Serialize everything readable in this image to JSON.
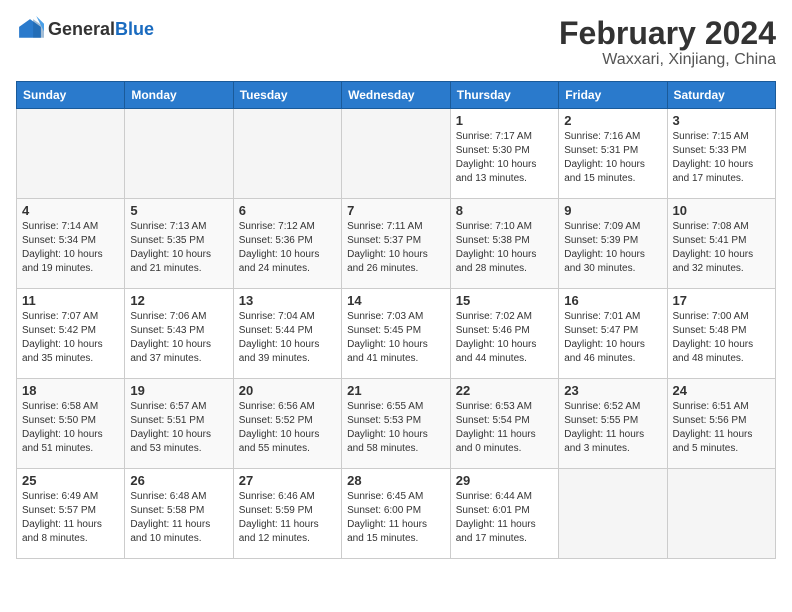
{
  "header": {
    "logo_general": "General",
    "logo_blue": "Blue",
    "title": "February 2024",
    "subtitle": "Waxxari, Xinjiang, China"
  },
  "weekdays": [
    "Sunday",
    "Monday",
    "Tuesday",
    "Wednesday",
    "Thursday",
    "Friday",
    "Saturday"
  ],
  "weeks": [
    [
      {
        "day": "",
        "info": ""
      },
      {
        "day": "",
        "info": ""
      },
      {
        "day": "",
        "info": ""
      },
      {
        "day": "",
        "info": ""
      },
      {
        "day": "1",
        "info": "Sunrise: 7:17 AM\nSunset: 5:30 PM\nDaylight: 10 hours\nand 13 minutes."
      },
      {
        "day": "2",
        "info": "Sunrise: 7:16 AM\nSunset: 5:31 PM\nDaylight: 10 hours\nand 15 minutes."
      },
      {
        "day": "3",
        "info": "Sunrise: 7:15 AM\nSunset: 5:33 PM\nDaylight: 10 hours\nand 17 minutes."
      }
    ],
    [
      {
        "day": "4",
        "info": "Sunrise: 7:14 AM\nSunset: 5:34 PM\nDaylight: 10 hours\nand 19 minutes."
      },
      {
        "day": "5",
        "info": "Sunrise: 7:13 AM\nSunset: 5:35 PM\nDaylight: 10 hours\nand 21 minutes."
      },
      {
        "day": "6",
        "info": "Sunrise: 7:12 AM\nSunset: 5:36 PM\nDaylight: 10 hours\nand 24 minutes."
      },
      {
        "day": "7",
        "info": "Sunrise: 7:11 AM\nSunset: 5:37 PM\nDaylight: 10 hours\nand 26 minutes."
      },
      {
        "day": "8",
        "info": "Sunrise: 7:10 AM\nSunset: 5:38 PM\nDaylight: 10 hours\nand 28 minutes."
      },
      {
        "day": "9",
        "info": "Sunrise: 7:09 AM\nSunset: 5:39 PM\nDaylight: 10 hours\nand 30 minutes."
      },
      {
        "day": "10",
        "info": "Sunrise: 7:08 AM\nSunset: 5:41 PM\nDaylight: 10 hours\nand 32 minutes."
      }
    ],
    [
      {
        "day": "11",
        "info": "Sunrise: 7:07 AM\nSunset: 5:42 PM\nDaylight: 10 hours\nand 35 minutes."
      },
      {
        "day": "12",
        "info": "Sunrise: 7:06 AM\nSunset: 5:43 PM\nDaylight: 10 hours\nand 37 minutes."
      },
      {
        "day": "13",
        "info": "Sunrise: 7:04 AM\nSunset: 5:44 PM\nDaylight: 10 hours\nand 39 minutes."
      },
      {
        "day": "14",
        "info": "Sunrise: 7:03 AM\nSunset: 5:45 PM\nDaylight: 10 hours\nand 41 minutes."
      },
      {
        "day": "15",
        "info": "Sunrise: 7:02 AM\nSunset: 5:46 PM\nDaylight: 10 hours\nand 44 minutes."
      },
      {
        "day": "16",
        "info": "Sunrise: 7:01 AM\nSunset: 5:47 PM\nDaylight: 10 hours\nand 46 minutes."
      },
      {
        "day": "17",
        "info": "Sunrise: 7:00 AM\nSunset: 5:48 PM\nDaylight: 10 hours\nand 48 minutes."
      }
    ],
    [
      {
        "day": "18",
        "info": "Sunrise: 6:58 AM\nSunset: 5:50 PM\nDaylight: 10 hours\nand 51 minutes."
      },
      {
        "day": "19",
        "info": "Sunrise: 6:57 AM\nSunset: 5:51 PM\nDaylight: 10 hours\nand 53 minutes."
      },
      {
        "day": "20",
        "info": "Sunrise: 6:56 AM\nSunset: 5:52 PM\nDaylight: 10 hours\nand 55 minutes."
      },
      {
        "day": "21",
        "info": "Sunrise: 6:55 AM\nSunset: 5:53 PM\nDaylight: 10 hours\nand 58 minutes."
      },
      {
        "day": "22",
        "info": "Sunrise: 6:53 AM\nSunset: 5:54 PM\nDaylight: 11 hours\nand 0 minutes."
      },
      {
        "day": "23",
        "info": "Sunrise: 6:52 AM\nSunset: 5:55 PM\nDaylight: 11 hours\nand 3 minutes."
      },
      {
        "day": "24",
        "info": "Sunrise: 6:51 AM\nSunset: 5:56 PM\nDaylight: 11 hours\nand 5 minutes."
      }
    ],
    [
      {
        "day": "25",
        "info": "Sunrise: 6:49 AM\nSunset: 5:57 PM\nDaylight: 11 hours\nand 8 minutes."
      },
      {
        "day": "26",
        "info": "Sunrise: 6:48 AM\nSunset: 5:58 PM\nDaylight: 11 hours\nand 10 minutes."
      },
      {
        "day": "27",
        "info": "Sunrise: 6:46 AM\nSunset: 5:59 PM\nDaylight: 11 hours\nand 12 minutes."
      },
      {
        "day": "28",
        "info": "Sunrise: 6:45 AM\nSunset: 6:00 PM\nDaylight: 11 hours\nand 15 minutes."
      },
      {
        "day": "29",
        "info": "Sunrise: 6:44 AM\nSunset: 6:01 PM\nDaylight: 11 hours\nand 17 minutes."
      },
      {
        "day": "",
        "info": ""
      },
      {
        "day": "",
        "info": ""
      }
    ]
  ]
}
